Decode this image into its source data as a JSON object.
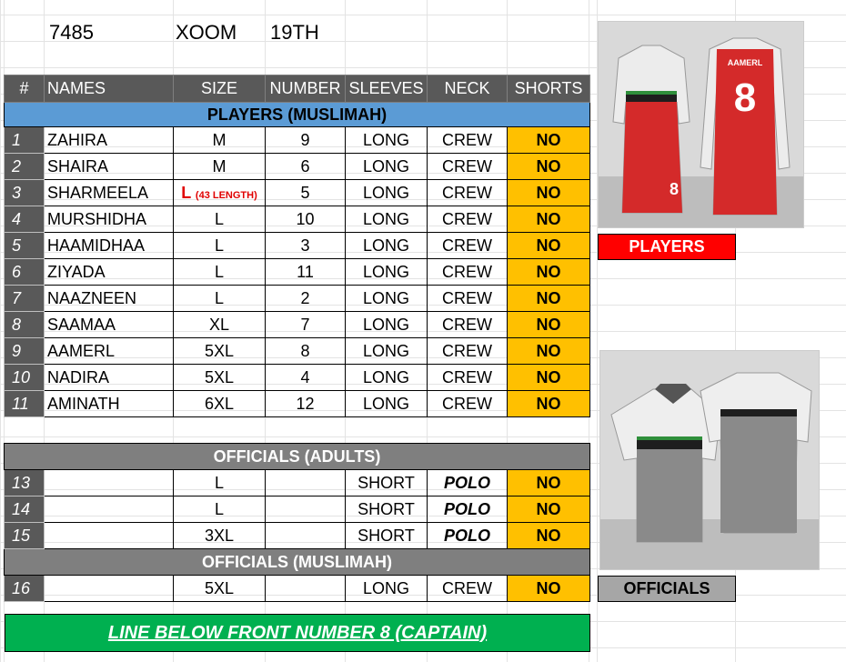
{
  "header": {
    "order_no": "7485",
    "client": "XOOM",
    "date": "19TH"
  },
  "columns": [
    "#",
    "NAMES",
    "SIZE",
    "NUMBER",
    "SLEEVES",
    "NECK",
    "SHORTS"
  ],
  "sections": {
    "players": "PLAYERS (MUSLIMAH)",
    "officials_adults": "OFFICIALS (ADULTS)",
    "officials_muslimah": "OFFICIALS (MUSLIMAH)"
  },
  "players": [
    {
      "idx": "1",
      "name": "ZAHIRA",
      "size": "M",
      "number": "9",
      "sleeves": "LONG",
      "neck": "CREW",
      "shorts": "NO"
    },
    {
      "idx": "2",
      "name": "SHAIRA",
      "size": "M",
      "number": "6",
      "sleeves": "LONG",
      "neck": "CREW",
      "shorts": "NO"
    },
    {
      "idx": "3",
      "name": "SHARMEELA",
      "size": "L",
      "size_note": "(43 LENGTH)",
      "number": "5",
      "sleeves": "LONG",
      "neck": "CREW",
      "shorts": "NO"
    },
    {
      "idx": "4",
      "name": "MURSHIDHA",
      "size": "L",
      "number": "10",
      "sleeves": "LONG",
      "neck": "CREW",
      "shorts": "NO"
    },
    {
      "idx": "5",
      "name": "HAAMIDHAA",
      "size": "L",
      "number": "3",
      "sleeves": "LONG",
      "neck": "CREW",
      "shorts": "NO"
    },
    {
      "idx": "6",
      "name": "ZIYADA",
      "size": "L",
      "number": "11",
      "sleeves": "LONG",
      "neck": "CREW",
      "shorts": "NO"
    },
    {
      "idx": "7",
      "name": "NAAZNEEN",
      "size": "L",
      "number": "2",
      "sleeves": "LONG",
      "neck": "CREW",
      "shorts": "NO"
    },
    {
      "idx": "8",
      "name": "SAAMAA",
      "size": "XL",
      "number": "7",
      "sleeves": "LONG",
      "neck": "CREW",
      "shorts": "NO"
    },
    {
      "idx": "9",
      "name": "AAMERL",
      "size": "5XL",
      "number": "8",
      "sleeves": "LONG",
      "neck": "CREW",
      "shorts": "NO"
    },
    {
      "idx": "10",
      "name": "NADIRA",
      "size": "5XL",
      "number": "4",
      "sleeves": "LONG",
      "neck": "CREW",
      "shorts": "NO"
    },
    {
      "idx": "11",
      "name": "AMINATH",
      "size": "6XL",
      "number": "12",
      "sleeves": "LONG",
      "neck": "CREW",
      "shorts": "NO"
    }
  ],
  "officials_adults": [
    {
      "idx": "13",
      "name": "",
      "size": "L",
      "number": "",
      "sleeves": "SHORT",
      "neck": "POLO",
      "shorts": "NO"
    },
    {
      "idx": "14",
      "name": "",
      "size": "L",
      "number": "",
      "sleeves": "SHORT",
      "neck": "POLO",
      "shorts": "NO"
    },
    {
      "idx": "15",
      "name": "",
      "size": "3XL",
      "number": "",
      "sleeves": "SHORT",
      "neck": "POLO",
      "shorts": "NO"
    }
  ],
  "officials_muslimah": [
    {
      "idx": "16",
      "name": "",
      "size": "5XL",
      "number": "",
      "sleeves": "LONG",
      "neck": "CREW",
      "shorts": "NO"
    }
  ],
  "mockups": {
    "players_label": "PLAYERS",
    "officials_label": "OFFICIALS",
    "jersey_name": "AAMERL",
    "jersey_number": "8"
  },
  "footer_note": "LINE BELOW FRONT NUMBER 8 (CAPTAIN)",
  "colors": {
    "shorts_no": "#ffc000",
    "section_blue": "#5b9bd5",
    "header_gray": "#595959",
    "players_red": "#ff0000",
    "footer_green": "#00b050"
  }
}
